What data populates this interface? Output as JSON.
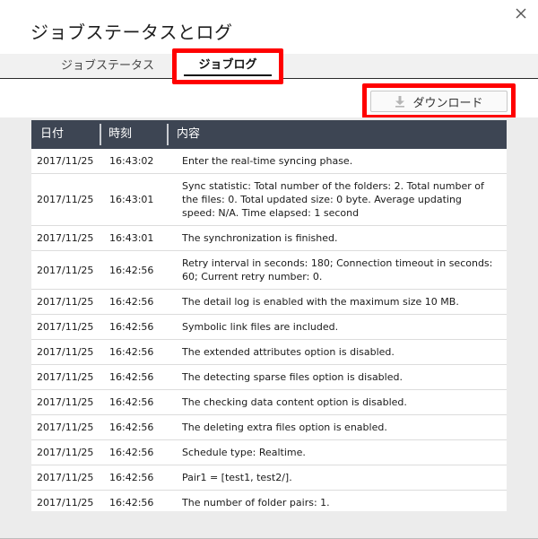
{
  "dialog": {
    "title": "ジョブステータスとログ"
  },
  "tabs": [
    {
      "label": "ジョブステータス",
      "active": false
    },
    {
      "label": "ジョブログ",
      "active": true
    }
  ],
  "toolbar": {
    "download_label": "ダウンロード"
  },
  "table": {
    "headers": [
      "日付",
      "時刻",
      "内容"
    ],
    "rows": [
      {
        "date": "2017/11/25",
        "time": "16:43:02",
        "text": "Enter the real-time syncing phase."
      },
      {
        "date": "2017/11/25",
        "time": "16:43:01",
        "text": "Sync statistic: Total number of the folders: 2. Total number of the files: 0. Total updated size: 0 byte. Average updating speed: N/A. Time elapsed: 1 second"
      },
      {
        "date": "2017/11/25",
        "time": "16:43:01",
        "text": "The synchronization is finished."
      },
      {
        "date": "2017/11/25",
        "time": "16:42:56",
        "text": "Retry interval in seconds: 180; Connection timeout in seconds: 60; Current retry number: 0."
      },
      {
        "date": "2017/11/25",
        "time": "16:42:56",
        "text": "The detail log is enabled with the maximum size 10 MB."
      },
      {
        "date": "2017/11/25",
        "time": "16:42:56",
        "text": "Symbolic link files are included."
      },
      {
        "date": "2017/11/25",
        "time": "16:42:56",
        "text": "The extended attributes option is disabled."
      },
      {
        "date": "2017/11/25",
        "time": "16:42:56",
        "text": "The detecting sparse files option is disabled."
      },
      {
        "date": "2017/11/25",
        "time": "16:42:56",
        "text": "The checking data content option is disabled."
      },
      {
        "date": "2017/11/25",
        "time": "16:42:56",
        "text": "The deleting extra files option is enabled."
      },
      {
        "date": "2017/11/25",
        "time": "16:42:56",
        "text": "Schedule type: Realtime."
      },
      {
        "date": "2017/11/25",
        "time": "16:42:56",
        "text": "Pair1 = [test1, test2/]."
      },
      {
        "date": "2017/11/25",
        "time": "16:42:56",
        "text": "The number of folder pairs: 1."
      }
    ]
  }
}
